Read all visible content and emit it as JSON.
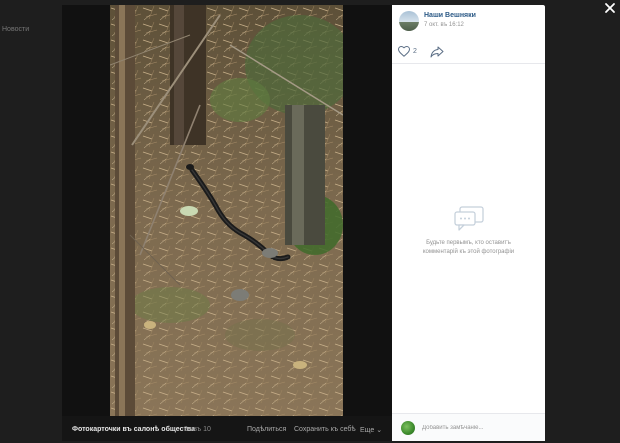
{
  "background": {
    "page_hint_text": "Новости"
  },
  "viewer": {
    "album_title": "Фотокарточки въ салонѣ общества",
    "counter": "9 изъ 10",
    "share_label": "Подѣлиться",
    "save_label": "Сохранить къ себѣ",
    "more_label": "Еще"
  },
  "post": {
    "owner_name": "Наши Вешняки",
    "date": "7 окт. въ 16:12",
    "likes": "2"
  },
  "comments": {
    "empty_text": "Будьте первымъ, кто оставитъ комментарій къ этой фотографіи",
    "placeholder": "Добавить замѣчаніе..."
  },
  "icons": {
    "like": "heart-icon",
    "share": "share-arrow-icon",
    "comments": "comments-icon",
    "close": "close-icon"
  },
  "colors": {
    "link": "#2a5885",
    "muted": "#939393",
    "overlay": "#000000"
  }
}
